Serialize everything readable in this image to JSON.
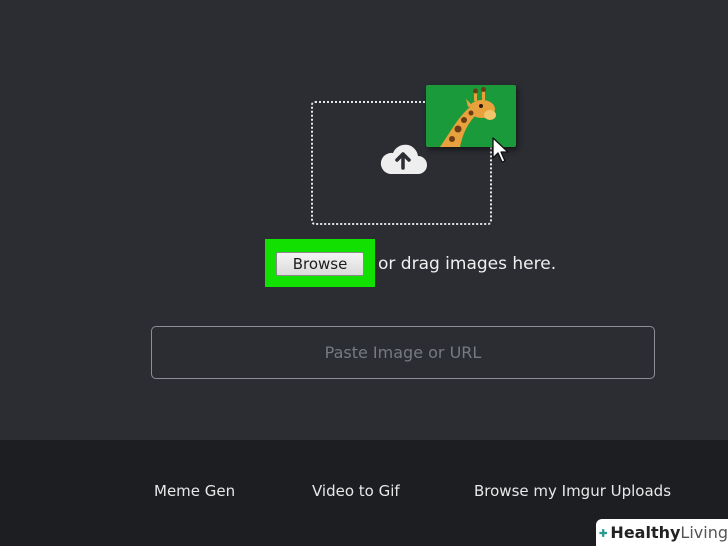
{
  "upload": {
    "browse_label": "Browse",
    "drag_text": "or drag images here.",
    "url_placeholder": "Paste Image or URL",
    "icons": [
      "cloud-upload-icon",
      "giraffe-image-icon",
      "mouse-cursor-icon"
    ]
  },
  "footer": {
    "links": [
      {
        "label": "Meme Gen"
      },
      {
        "label": "Video to Gif"
      },
      {
        "label": "Browse my Imgur Uploads"
      }
    ]
  },
  "watermark": {
    "text_a": "Healthy",
    "text_b": "Living"
  },
  "colors": {
    "background": "#2b2d33",
    "footer": "#1c1e22",
    "highlight": "#11e000",
    "card": "#1a9a3a"
  }
}
